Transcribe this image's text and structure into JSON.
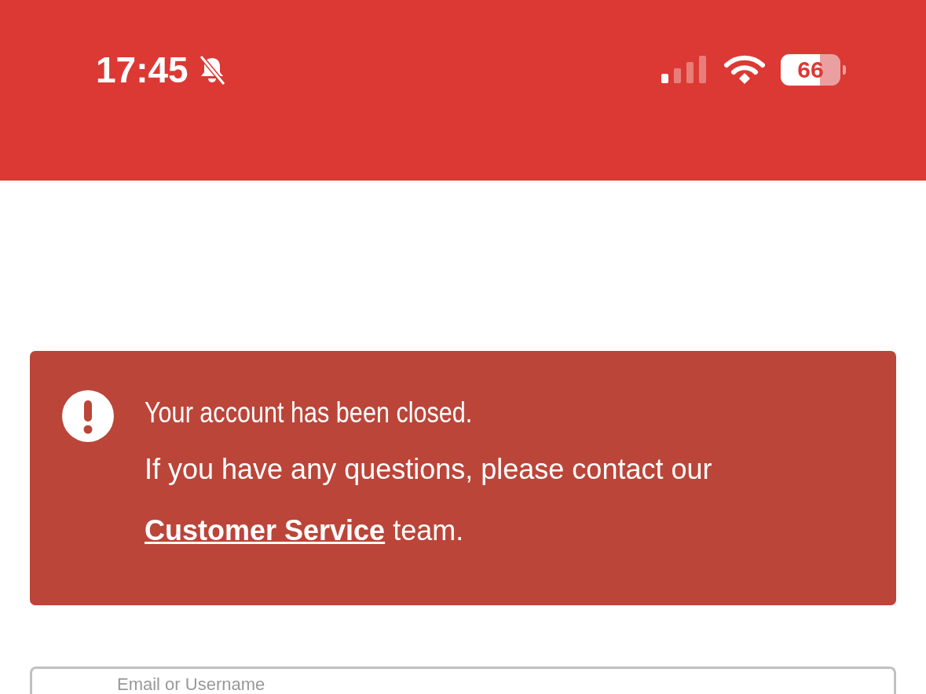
{
  "status_bar": {
    "time": "17:45",
    "silent": true,
    "battery": "66"
  },
  "alert": {
    "title": "Your account has been closed.",
    "text_before_link": "If you have any questions, please contact our",
    "link": "Customer Service",
    "text_after_link": "team."
  },
  "login": {
    "email_field": {
      "placeholder": "Email or Username"
    }
  }
}
